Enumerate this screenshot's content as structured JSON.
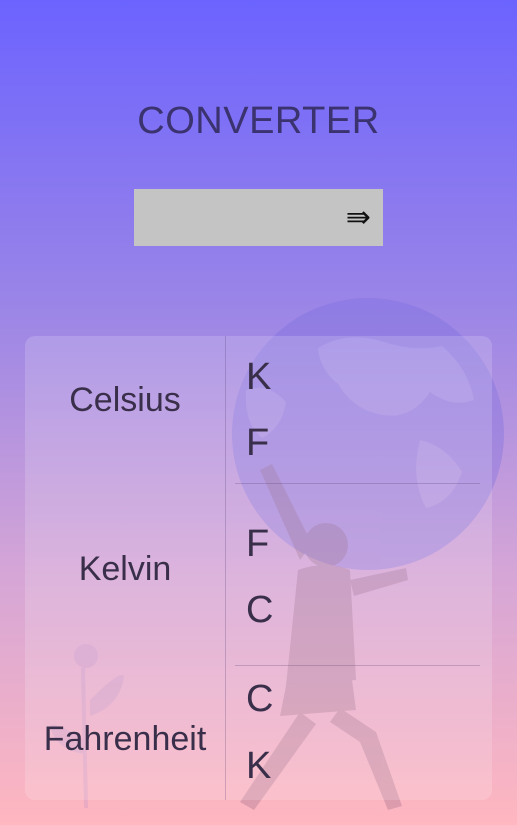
{
  "header": {
    "title": "CONVERTER"
  },
  "input": {
    "value": "",
    "placeholder": "",
    "submit_icon": "double-arrow-right-icon"
  },
  "conversions": [
    {
      "from": "Celsius",
      "targets": [
        "K",
        "F"
      ]
    },
    {
      "from": "Kelvin",
      "targets": [
        "F",
        "C"
      ]
    },
    {
      "from": "Fahrenheit",
      "targets": [
        "C",
        "K"
      ]
    }
  ],
  "colors": {
    "title": "#3b3370",
    "input_bg": "#c4c4c4",
    "text": "#3a2f4a"
  }
}
